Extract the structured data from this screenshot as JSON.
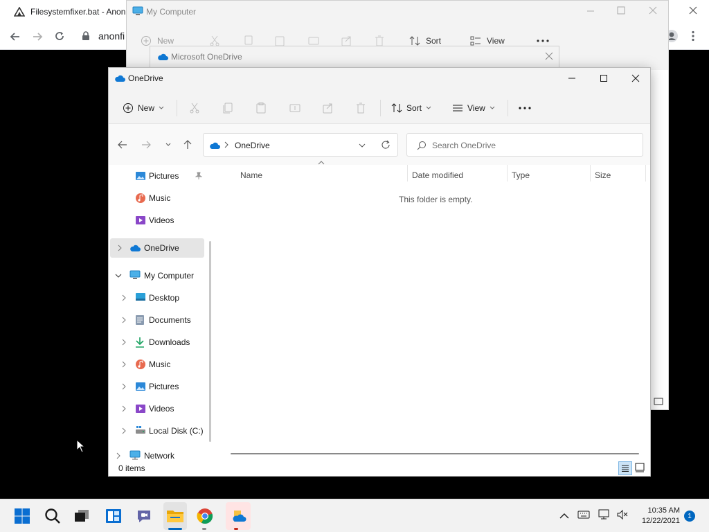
{
  "browser": {
    "tab_title": "Filesystemfixer.bat - Anon",
    "address": "anonfi"
  },
  "bg_window": {
    "title": "My Computer",
    "toolbar": {
      "new": "New",
      "sort": "Sort",
      "view": "View"
    }
  },
  "bg_dialog": {
    "title": "Microsoft OneDrive"
  },
  "explorer": {
    "title": "OneDrive",
    "toolbar": {
      "new": "New",
      "sort": "Sort",
      "view": "View",
      "more": "..."
    },
    "address": {
      "location": "OneDrive"
    },
    "search": {
      "placeholder": "Search OneDrive"
    },
    "nav": {
      "quick": [
        {
          "label": "Pictures",
          "icon": "pictures-icon"
        },
        {
          "label": "Music",
          "icon": "music-icon"
        },
        {
          "label": "Videos",
          "icon": "videos-icon"
        }
      ],
      "onedrive": "OneDrive",
      "mycomputer": "My Computer",
      "pc_items": [
        {
          "label": "Desktop",
          "icon": "desktop-icon"
        },
        {
          "label": "Documents",
          "icon": "documents-icon"
        },
        {
          "label": "Downloads",
          "icon": "downloads-icon"
        },
        {
          "label": "Music",
          "icon": "music-icon"
        },
        {
          "label": "Pictures",
          "icon": "pictures-icon"
        },
        {
          "label": "Videos",
          "icon": "videos-icon"
        },
        {
          "label": "Local Disk (C:)",
          "icon": "local-disk-icon"
        }
      ],
      "network": "Network"
    },
    "columns": {
      "name": "Name",
      "date": "Date modified",
      "type": "Type",
      "size": "Size"
    },
    "empty_message": "This folder is empty.",
    "status": "0 items"
  },
  "taskbar": {
    "time": "10:35 AM",
    "date": "12/22/2021",
    "notification_count": "1"
  },
  "colors": {
    "accent": "#0067c0",
    "onedrive_blue": "#0f78d4",
    "selected_bg": "#e5e5e5"
  }
}
